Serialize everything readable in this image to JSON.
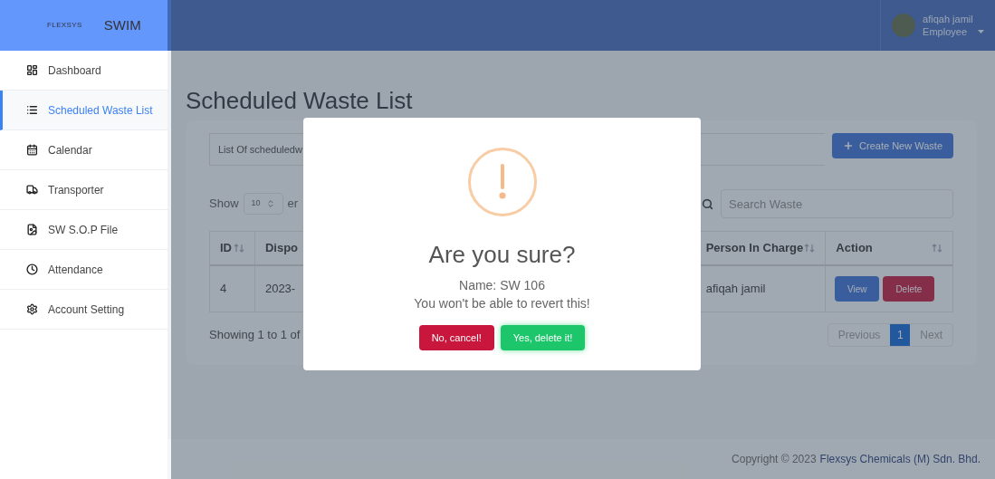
{
  "brand": {
    "logo": "FLEXSYS",
    "app": "SWIM"
  },
  "sidebar": {
    "items": [
      {
        "label": "Dashboard",
        "selected": false
      },
      {
        "label": "Scheduled Waste List",
        "selected": true
      },
      {
        "label": "Calendar",
        "selected": false
      },
      {
        "label": "Transporter",
        "selected": false
      },
      {
        "label": "SW S.O.P File",
        "selected": false
      },
      {
        "label": "Attendance",
        "selected": false
      },
      {
        "label": "Account Setting",
        "selected": false
      }
    ]
  },
  "user": {
    "name": "afiqah jamil",
    "role": "Employee"
  },
  "page_title": "Scheduled Waste List",
  "card": {
    "heading": "List Of scheduledw",
    "create_button": "Create New Waste",
    "show_label": "Show",
    "entries_value": "10",
    "entries_suffix": "er",
    "search_placeholder": "Search Waste",
    "columns": [
      "ID",
      "Dispo",
      "Person In Charge",
      "Action"
    ],
    "rows": [
      {
        "cells": [
          "4",
          "2023-",
          "afiqah jamil"
        ],
        "actions": [
          "View",
          "Delete"
        ]
      }
    ],
    "info": "Showing 1 to 1 of",
    "pagination": {
      "previous": "Previous",
      "pages": [
        {
          "label": "1",
          "selected": true
        }
      ],
      "next": "Next"
    }
  },
  "modal": {
    "title": "Are you sure?",
    "lines": [
      "Name: SW 106",
      "You won't be able to revert this!"
    ],
    "cancel": "No, cancel!",
    "confirm": "Yes, delete it!"
  },
  "footer": {
    "text": "Copyright © 2023",
    "link": "Flexsys Chemicals (M) Sdn. Bhd."
  }
}
